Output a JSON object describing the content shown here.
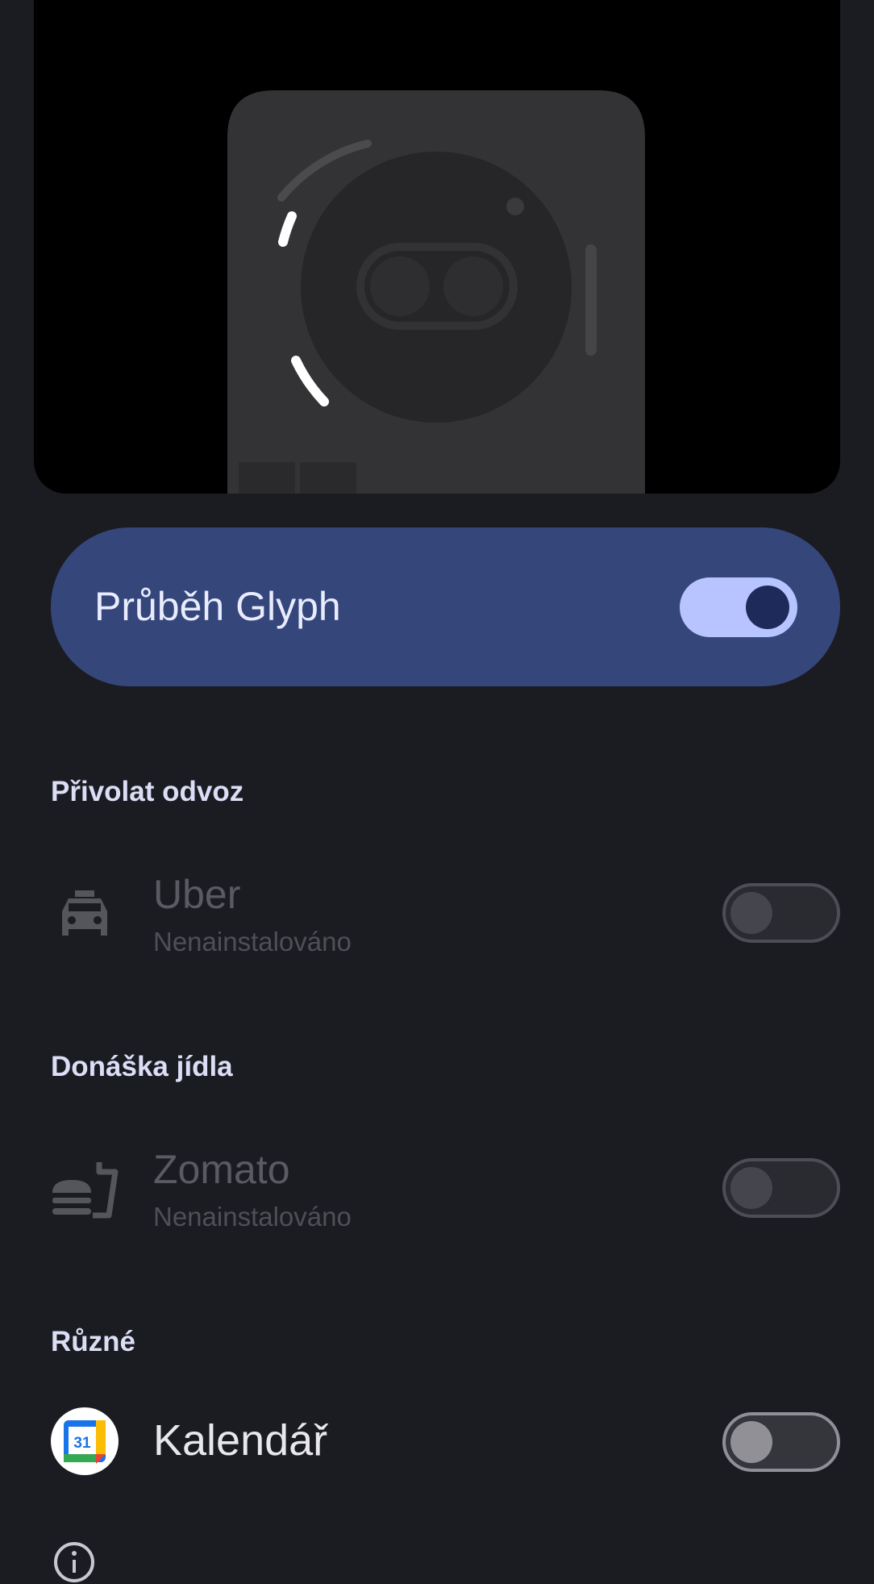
{
  "master": {
    "label": "Průběh Glyph",
    "enabled": true
  },
  "sections": {
    "ride": "Přivolat odvoz",
    "food": "Donáška jídla",
    "misc": "Různé"
  },
  "apps": {
    "uber": {
      "name": "Uber",
      "status": "Nenainstalováno",
      "enabled": false,
      "icon": "taxi-icon"
    },
    "zomato": {
      "name": "Zomato",
      "status": "Nenainstalováno",
      "enabled": false,
      "icon": "food-delivery-icon"
    },
    "calendar": {
      "name": "Kalendář",
      "day": "31",
      "enabled": false,
      "icon": "google-calendar-icon"
    }
  },
  "colors": {
    "background": "#1b1c21",
    "master_card": "#35467a",
    "toggle_on_track": "#b8c4ff",
    "toggle_on_knob": "#1d2a5a"
  }
}
